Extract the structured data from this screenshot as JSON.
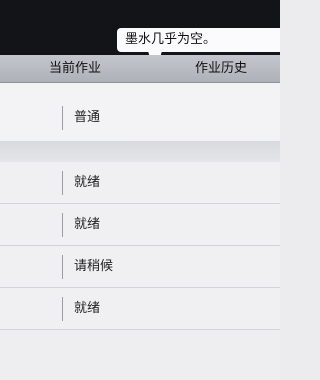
{
  "tooltip": {
    "text": "墨水几乎为空。"
  },
  "tabs": {
    "current": "当前作业",
    "history": "作业历史"
  },
  "jobs": [
    {
      "status": "普通"
    },
    {
      "status": "就绪"
    },
    {
      "status": "就绪"
    },
    {
      "status": "请稍候"
    },
    {
      "status": "就绪"
    }
  ]
}
